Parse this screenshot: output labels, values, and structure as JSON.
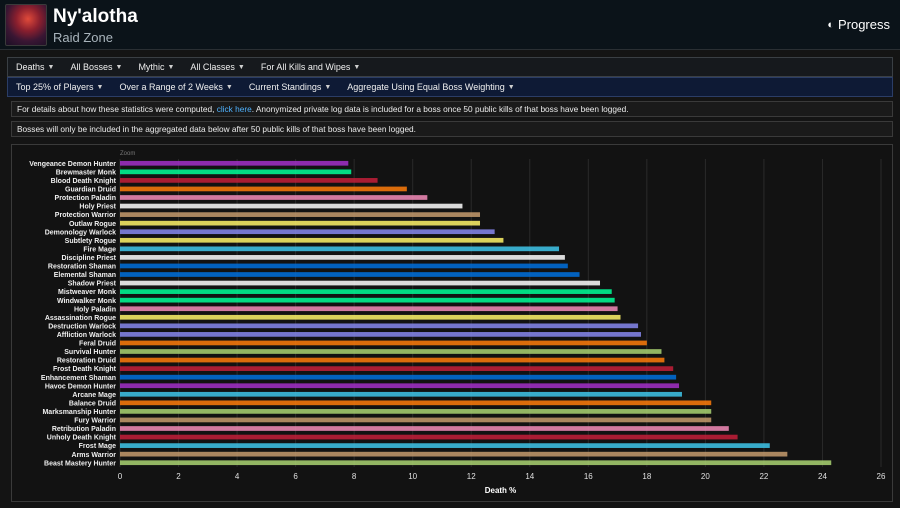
{
  "header": {
    "title": "Ny'alotha",
    "subtitle": "Raid Zone",
    "progress_label": "Progress"
  },
  "filters": {
    "row1": [
      "Deaths",
      "All Bosses",
      "Mythic",
      "All Classes",
      "For All Kills and Wipes"
    ],
    "row2": [
      "Top 25% of Players",
      "Over a Range of 2 Weeks",
      "Current Standings",
      "Aggregate Using Equal Boss Weighting"
    ]
  },
  "notices": {
    "n1_before": "For details about how these statistics were computed, ",
    "n1_link": "click here",
    "n1_after": ". Anonymized private log data is included for a boss once 50 public kills of that boss have been logged.",
    "n2": "Bosses will only be included in the aggregated data below after 50 public kills of that boss have been logged."
  },
  "chart_data": {
    "type": "bar",
    "orientation": "horizontal",
    "corner_label": "Zoom",
    "xlabel": "Death %",
    "xlim": [
      0,
      26
    ],
    "xticks": [
      0,
      2,
      4,
      6,
      8,
      10,
      12,
      14,
      16,
      18,
      20,
      22,
      24,
      26
    ],
    "grid": true,
    "categories": [
      "Vengeance Demon Hunter",
      "Brewmaster Monk",
      "Blood Death Knight",
      "Guardian Druid",
      "Protection Paladin",
      "Holy Priest",
      "Protection Warrior",
      "Outlaw Rogue",
      "Demonology Warlock",
      "Subtlety Rogue",
      "Fire Mage",
      "Discipline Priest",
      "Restoration Shaman",
      "Elemental Shaman",
      "Shadow Priest",
      "Mistweaver Monk",
      "Windwalker Monk",
      "Holy Paladin",
      "Assassination Rogue",
      "Destruction Warlock",
      "Affliction Warlock",
      "Feral Druid",
      "Survival Hunter",
      "Restoration Druid",
      "Frost Death Knight",
      "Enhancement Shaman",
      "Havoc Demon Hunter",
      "Arcane Mage",
      "Balance Druid",
      "Marksmanship Hunter",
      "Fury Warrior",
      "Retribution Paladin",
      "Unholy Death Knight",
      "Frost Mage",
      "Arms Warrior",
      "Beast Mastery Hunter"
    ],
    "values": [
      7.8,
      7.9,
      8.8,
      9.8,
      10.5,
      11.7,
      12.3,
      12.3,
      12.8,
      13.1,
      15.0,
      15.2,
      15.3,
      15.7,
      16.4,
      16.8,
      16.9,
      17.0,
      17.1,
      17.7,
      17.8,
      18.0,
      18.5,
      18.6,
      18.9,
      19.0,
      19.1,
      19.2,
      20.2,
      20.2,
      20.2,
      20.8,
      21.1,
      22.2,
      22.8,
      24.3
    ],
    "colors": [
      "#a330c9",
      "#00ff98",
      "#c41e3a",
      "#ff7c0a",
      "#f48cba",
      "#ffffff",
      "#c69b6d",
      "#fff468",
      "#8788ee",
      "#fff468",
      "#3fc7eb",
      "#ffffff",
      "#0070dd",
      "#0070dd",
      "#ffffff",
      "#00ff98",
      "#00ff98",
      "#f48cba",
      "#fff468",
      "#8788ee",
      "#8788ee",
      "#ff7c0a",
      "#aad372",
      "#ff7c0a",
      "#c41e3a",
      "#0070dd",
      "#a330c9",
      "#3fc7eb",
      "#ff7c0a",
      "#aad372",
      "#c69b6d",
      "#f48cba",
      "#c41e3a",
      "#3fc7eb",
      "#c69b6d",
      "#aad372"
    ]
  }
}
